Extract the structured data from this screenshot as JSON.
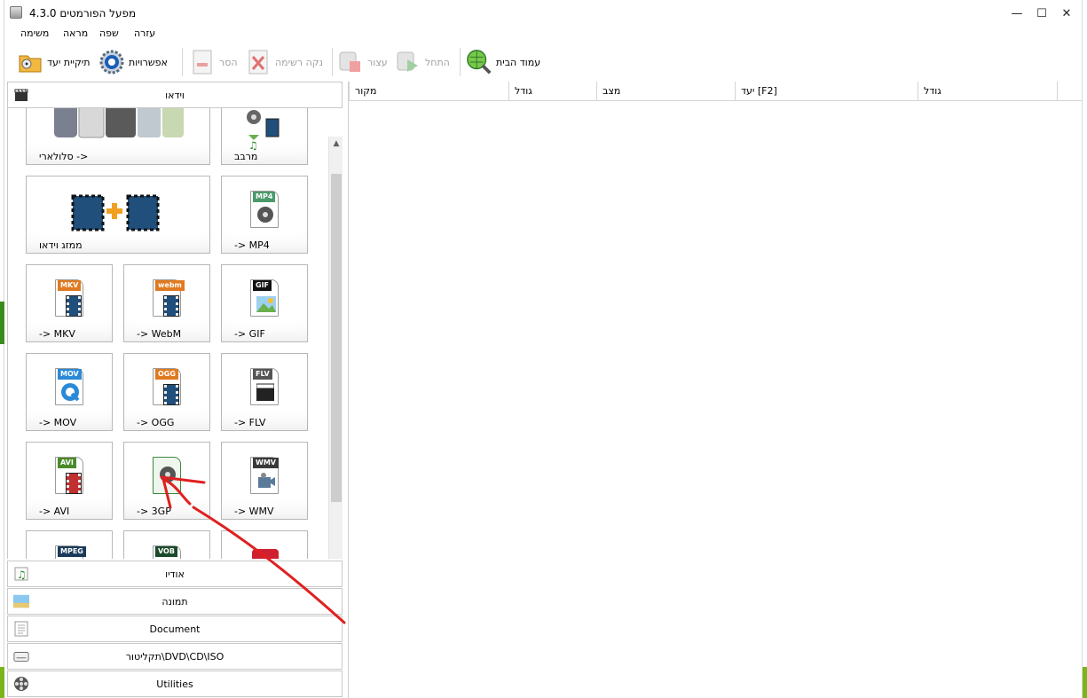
{
  "window": {
    "title": "מפעל הפורמטים 4.3.0",
    "minimize": "—",
    "maximize": "☐",
    "close": "✕"
  },
  "menu": {
    "items": [
      "משימה",
      "מראה",
      "שפה",
      "עזרה"
    ]
  },
  "toolbar": {
    "output_folder": "תיקיית יעד",
    "options": "אפשרויות",
    "remove": "הסר",
    "clear_list": "נקה רשימה",
    "stop": "עצור",
    "start": "התחל",
    "homepage": "עמוד הבית"
  },
  "categories": {
    "video": "וידאו",
    "audio": "אודיו",
    "picture": "תמונה",
    "document": "Document",
    "rom": "תקליטור\\DVD\\CD\\ISO",
    "utilities": "Utilities"
  },
  "tiles": {
    "mobile": "סלולארי ->",
    "mux": "מרבב",
    "joiner": "ממזג וידאו",
    "mp4": "-> MP4",
    "mkv": "-> MKV",
    "webm": "-> WebM",
    "gif": "-> GIF",
    "mov": "-> MOV",
    "ogg": "-> OGG",
    "flv": "-> FLV",
    "avi": "-> AVI",
    "3gp": "-> 3GP",
    "wmv": "-> WMV"
  },
  "badges": {
    "mp4": "MP4",
    "mkv": "MKV",
    "webm": "webm",
    "gif": "GIF",
    "mov": "MOV",
    "ogg": "OGG",
    "flv": "FLV",
    "avi": "AVI",
    "wmv": "WMV",
    "mpeg": "MPEG",
    "vob": "VOB"
  },
  "file_list": {
    "columns": [
      "מקור",
      "גודל",
      "מצב",
      "יעד [F2]",
      "גודל"
    ]
  },
  "colors": {
    "annotation": "#e02020",
    "mp4": "#4a9a6a",
    "mkv": "#e07a20",
    "webm": "#e07a20",
    "gif": "#111111",
    "mov": "#2a8ad8",
    "ogg": "#e07a20",
    "flv": "#555555",
    "avi": "#4a8a2a",
    "wmv": "#3a3a3a",
    "mpeg": "#1a3a5a",
    "vob": "#1a4a2a"
  }
}
